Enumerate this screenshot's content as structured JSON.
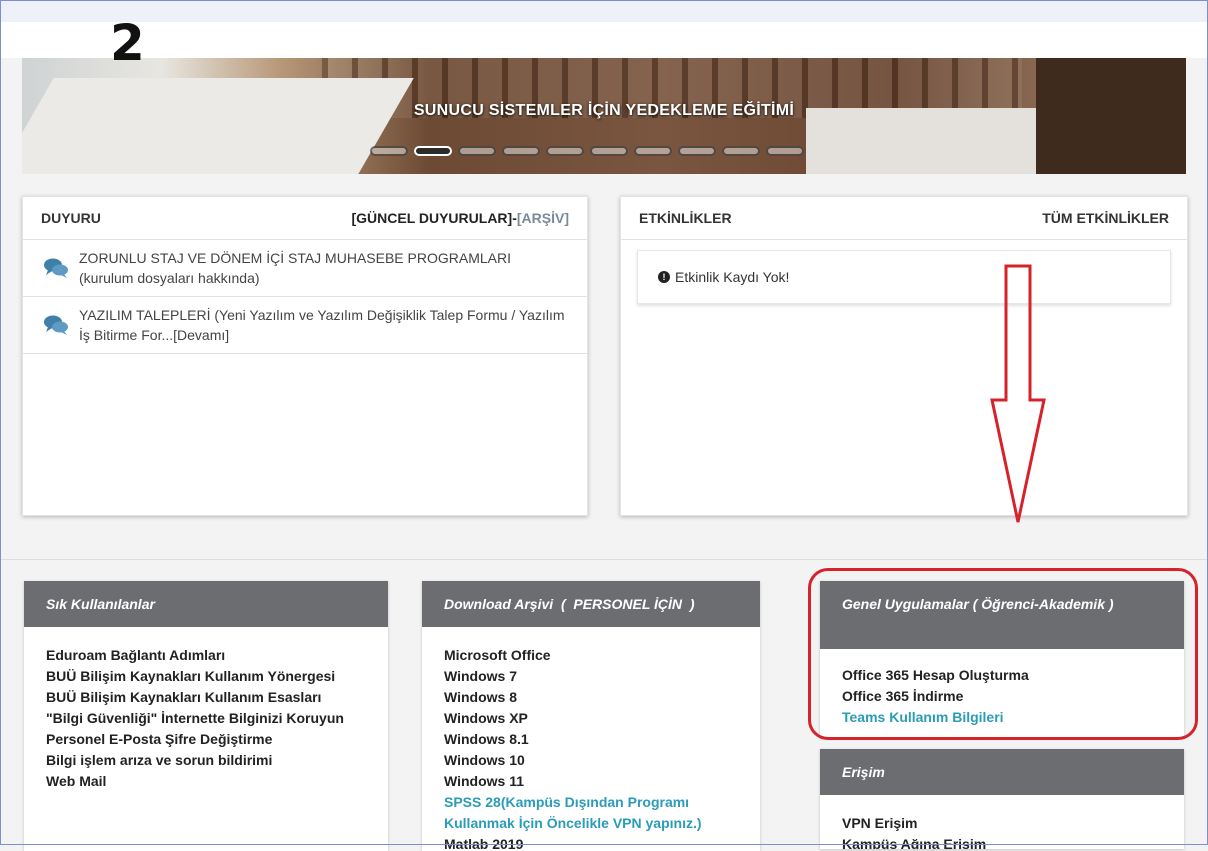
{
  "step_label": "2",
  "banner": {
    "title": "SUNUCU SİSTEMLER İÇİN YEDEKLEME EĞİTİMİ",
    "slides_count": 10,
    "active_slide": 2
  },
  "announcements": {
    "title": "DUYURU",
    "current_link": "[GÜNCEL DUYURULAR]-",
    "archive_link": "[ARŞİV]",
    "items": [
      {
        "text": "ZORUNLU STAJ VE DÖNEM İÇİ STAJ MUHASEBE PROGRAMLARI (kurulum dosyaları hakkında)"
      },
      {
        "text": "YAZILIM TALEPLERİ (Yeni Yazılım ve Yazılım Değişiklik Talep Formu / Yazılım İş Bitirme For...[Devamı]"
      }
    ]
  },
  "events": {
    "title": "ETKİNLİKLER",
    "all_link": "TÜM ETKİNLİKLER",
    "empty_message": "Etkinlik Kaydı Yok!"
  },
  "frequent": {
    "title": "Sık Kullanılanlar",
    "items": [
      "Eduroam Bağlantı Adımları",
      "BUÜ Bilişim Kaynakları Kullanım Yönergesi",
      "BUÜ Bilişim Kaynakları Kullanım Esasları",
      "\"Bilgi Güvenliği\" İnternette Bilginizi Koruyun",
      "Personel E-Posta Şifre Değiştirme",
      "Bilgi işlem arıza ve sorun bildirimi",
      "Web Mail"
    ]
  },
  "downloads": {
    "title": "Download Arşivi  (  PERSONEL İÇİN  )",
    "items": [
      "Microsoft Office",
      "Windows 7",
      "Windows 8",
      "Windows XP",
      "Windows 8.1",
      "Windows 10",
      "Windows 11"
    ],
    "highlight_link": "SPSS 28(Kampüs Dışından Programı Kullanmak İçin Öncelikle VPN yapınız.)",
    "last_item": "Matlab 2019"
  },
  "general_apps": {
    "title": "Genel Uygulamalar ( Öğrenci-Akademik )",
    "items": [
      "Office 365 Hesap Oluşturma",
      "Office 365 İndirme"
    ],
    "link": "Teams Kullanım Bilgileri"
  },
  "access": {
    "title": "Erişim",
    "items": [
      "VPN Erişim",
      "Kampüs Ağına Erişim"
    ]
  },
  "colors": {
    "annotation_red": "#d6232b",
    "link_teal": "#2b9cb6",
    "box_header": "#6b6d70"
  }
}
